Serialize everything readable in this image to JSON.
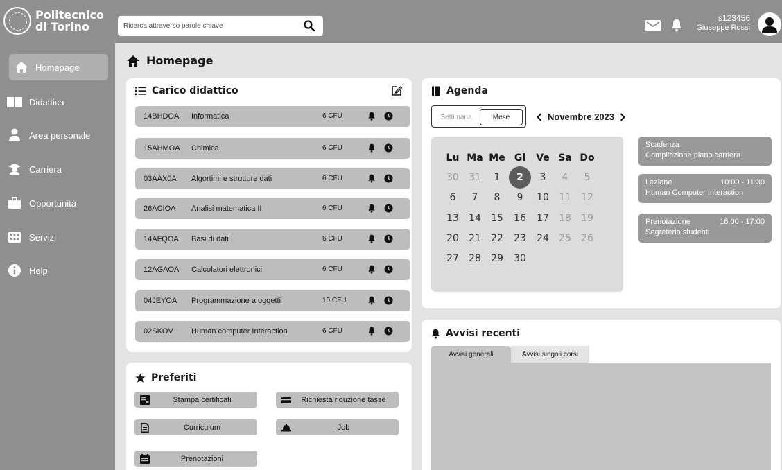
{
  "brand": {
    "line1": "Politecnico",
    "line2": "di Torino"
  },
  "search": {
    "placeholder": "Ricerca attraverso parole chiave"
  },
  "user": {
    "id": "s123456",
    "name": "Giuseppe Rossi"
  },
  "sidebar": {
    "items": [
      {
        "label": "Homepage",
        "icon": "home-icon"
      },
      {
        "label": "Didattica",
        "icon": "book-icon"
      },
      {
        "label": "Area personale",
        "icon": "person-icon"
      },
      {
        "label": "Carriera",
        "icon": "graduation-icon"
      },
      {
        "label": "Opportunità",
        "icon": "briefcase-icon"
      },
      {
        "label": "Servizi",
        "icon": "grid-icon"
      },
      {
        "label": "Help",
        "icon": "info-icon"
      }
    ]
  },
  "page": {
    "title": "Homepage"
  },
  "carico": {
    "title": "Carico didattico",
    "courses": [
      {
        "code": "14BHDOA",
        "name": "Informatica",
        "cfu": "6 CFU"
      },
      {
        "code": "15AHMOA",
        "name": "Chimica",
        "cfu": "6 CFU"
      },
      {
        "code": "03AAX0A",
        "name": "Algortimi e strutture dati",
        "cfu": "6 CFU"
      },
      {
        "code": "26ACIOA",
        "name": "Analisi matematica II",
        "cfu": "6 CFU"
      },
      {
        "code": "14AFQOA",
        "name": "Basi di dati",
        "cfu": "6 CFU"
      },
      {
        "code": "12AGAOA",
        "name": "Calcolatori elettronici",
        "cfu": "6 CFU"
      },
      {
        "code": "04JEYOA",
        "name": "Programmazione a oggetti",
        "cfu": "10 CFU"
      },
      {
        "code": "02SKOV",
        "name": "Human computer Interaction",
        "cfu": "6 CFU"
      }
    ]
  },
  "preferiti": {
    "title": "Preferiti",
    "items": [
      {
        "label": "Stampa certificati",
        "icon": "certificate-icon"
      },
      {
        "label": "Richiesta riduzione tasse",
        "icon": "wallet-icon"
      },
      {
        "label": "Curriculum",
        "icon": "document-icon"
      },
      {
        "label": "Job",
        "icon": "helmet-icon"
      },
      {
        "label": "Prenotazioni",
        "icon": "calendar-icon"
      }
    ]
  },
  "agenda": {
    "title": "Agenda",
    "view_week": "Settimana",
    "view_month": "Mese",
    "month": "Novembre 2023",
    "weekdays": [
      "Lu",
      "Ma",
      "Me",
      "Gi",
      "Ve",
      "Sa",
      "Do"
    ],
    "weeks": [
      [
        "30",
        "31",
        "1",
        "2",
        "3",
        "4",
        "5"
      ],
      [
        "6",
        "7",
        "8",
        "9",
        "10",
        "11",
        "12"
      ],
      [
        "13",
        "14",
        "15",
        "16",
        "17",
        "18",
        "19"
      ],
      [
        "20",
        "21",
        "22",
        "23",
        "24",
        "25",
        "26"
      ],
      [
        "27",
        "28",
        "29",
        "30",
        "",
        "",
        ""
      ]
    ],
    "today": "2",
    "events": [
      {
        "type": "Scadenza",
        "time": "",
        "desc": "Compilazione piano carriera"
      },
      {
        "type": "Lezione",
        "time": "10:00 - 11:30",
        "desc": "Human Computer Interaction"
      },
      {
        "type": "Prenotazione",
        "time": "16:00 - 17:00",
        "desc": "Segreteria studenti"
      }
    ]
  },
  "avvisi": {
    "title": "Avvisi recenti",
    "tabs": [
      "Avvisi generali",
      "Avvisi singoli corsi"
    ]
  }
}
